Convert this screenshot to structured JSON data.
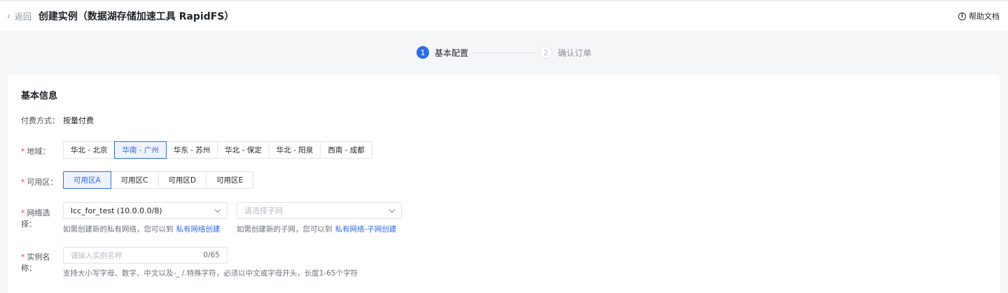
{
  "header": {
    "back_label": "返回",
    "title": "创建实例（数据湖存储加速工具 RapidFS）",
    "help_label": "帮助文档"
  },
  "steps": [
    {
      "num": "1",
      "label": "基本配置",
      "active": true
    },
    {
      "num": "2",
      "label": "确认订单",
      "active": false
    }
  ],
  "form": {
    "section_title": "基本信息",
    "payment": {
      "label": "付费方式：",
      "value": "按量付费"
    },
    "region": {
      "label": "地域：",
      "options": [
        "华北 - 北京",
        "华南 - 广州",
        "华东 - 苏州",
        "华北 - 保定",
        "华北 - 阳泉",
        "西南 - 成都"
      ],
      "selected": "华南 - 广州"
    },
    "zone": {
      "label": "可用区：",
      "options": [
        "可用区A",
        "可用区C",
        "可用区D",
        "可用区E"
      ],
      "selected": "可用区A"
    },
    "network": {
      "label": "网络选择：",
      "vpc_value": "lcc_for_test (10.0.0.0/8)",
      "subnet_placeholder": "请选择子网",
      "vpc_hint": "如需创建新的私有网络，您可以到",
      "vpc_link": "私有网络创建",
      "subnet_hint": "如需创建新的子网，您可以到",
      "subnet_link": "私有网络-子网创建"
    },
    "instance_name": {
      "label": "实例名称：",
      "placeholder": "请输入实例名称",
      "counter": "0/65",
      "hint": "支持大小写字母、数字、中文以及-_ /.特殊字符，必须以中文或字母开头，长度1-65个字符"
    }
  }
}
